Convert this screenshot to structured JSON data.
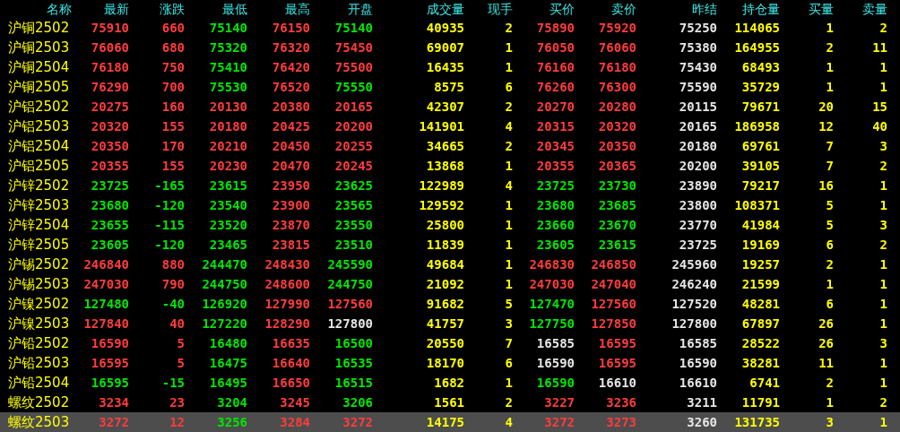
{
  "table": {
    "columns": [
      "名称",
      "最新",
      "涨跌",
      "最低",
      "最高",
      "开盘",
      "成交量",
      "现手",
      "买价",
      "卖价",
      "昨结",
      "持仓量",
      "买量",
      "卖量"
    ],
    "rows": [
      {
        "selected": false,
        "cells": [
          {
            "text": "沪铜2502",
            "color": "#ffff00"
          },
          {
            "text": "75910",
            "color": "#ff3c3c"
          },
          {
            "text": "660",
            "color": "#ff3c3c"
          },
          {
            "text": "75140",
            "color": "#00e600"
          },
          {
            "text": "76150",
            "color": "#ff3c3c"
          },
          {
            "text": "75140",
            "color": "#00e600"
          },
          {
            "text": "40935",
            "color": "#ffff00"
          },
          {
            "text": "2",
            "color": "#ffff00"
          },
          {
            "text": "75890",
            "color": "#ff3c3c"
          },
          {
            "text": "75920",
            "color": "#ff3c3c"
          },
          {
            "text": "75250",
            "color": "#e6e6e6"
          },
          {
            "text": "114065",
            "color": "#ffff00"
          },
          {
            "text": "1",
            "color": "#ffff00"
          },
          {
            "text": "2",
            "color": "#ffff00"
          }
        ]
      },
      {
        "selected": false,
        "cells": [
          {
            "text": "沪铜2503",
            "color": "#ffff00"
          },
          {
            "text": "76060",
            "color": "#ff3c3c"
          },
          {
            "text": "680",
            "color": "#ff3c3c"
          },
          {
            "text": "75320",
            "color": "#00e600"
          },
          {
            "text": "76320",
            "color": "#ff3c3c"
          },
          {
            "text": "75450",
            "color": "#ff3c3c"
          },
          {
            "text": "69007",
            "color": "#ffff00"
          },
          {
            "text": "1",
            "color": "#ffff00"
          },
          {
            "text": "76050",
            "color": "#ff3c3c"
          },
          {
            "text": "76060",
            "color": "#ff3c3c"
          },
          {
            "text": "75380",
            "color": "#e6e6e6"
          },
          {
            "text": "164955",
            "color": "#ffff00"
          },
          {
            "text": "2",
            "color": "#ffff00"
          },
          {
            "text": "11",
            "color": "#ffff00"
          }
        ]
      },
      {
        "selected": false,
        "cells": [
          {
            "text": "沪铜2504",
            "color": "#ffff00"
          },
          {
            "text": "76180",
            "color": "#ff3c3c"
          },
          {
            "text": "750",
            "color": "#ff3c3c"
          },
          {
            "text": "75410",
            "color": "#00e600"
          },
          {
            "text": "76420",
            "color": "#ff3c3c"
          },
          {
            "text": "75500",
            "color": "#ff3c3c"
          },
          {
            "text": "16435",
            "color": "#ffff00"
          },
          {
            "text": "1",
            "color": "#ffff00"
          },
          {
            "text": "76160",
            "color": "#ff3c3c"
          },
          {
            "text": "76180",
            "color": "#ff3c3c"
          },
          {
            "text": "75430",
            "color": "#e6e6e6"
          },
          {
            "text": "68493",
            "color": "#ffff00"
          },
          {
            "text": "1",
            "color": "#ffff00"
          },
          {
            "text": "1",
            "color": "#ffff00"
          }
        ]
      },
      {
        "selected": false,
        "cells": [
          {
            "text": "沪铜2505",
            "color": "#ffff00"
          },
          {
            "text": "76290",
            "color": "#ff3c3c"
          },
          {
            "text": "700",
            "color": "#ff3c3c"
          },
          {
            "text": "75530",
            "color": "#00e600"
          },
          {
            "text": "76520",
            "color": "#ff3c3c"
          },
          {
            "text": "75550",
            "color": "#00e600"
          },
          {
            "text": "8575",
            "color": "#ffff00"
          },
          {
            "text": "6",
            "color": "#ffff00"
          },
          {
            "text": "76260",
            "color": "#ff3c3c"
          },
          {
            "text": "76300",
            "color": "#ff3c3c"
          },
          {
            "text": "75590",
            "color": "#e6e6e6"
          },
          {
            "text": "35729",
            "color": "#ffff00"
          },
          {
            "text": "1",
            "color": "#ffff00"
          },
          {
            "text": "1",
            "color": "#ffff00"
          }
        ]
      },
      {
        "selected": false,
        "cells": [
          {
            "text": "沪铝2502",
            "color": "#ffff00"
          },
          {
            "text": "20275",
            "color": "#ff3c3c"
          },
          {
            "text": "160",
            "color": "#ff3c3c"
          },
          {
            "text": "20130",
            "color": "#ff3c3c"
          },
          {
            "text": "20380",
            "color": "#ff3c3c"
          },
          {
            "text": "20165",
            "color": "#ff3c3c"
          },
          {
            "text": "42307",
            "color": "#ffff00"
          },
          {
            "text": "2",
            "color": "#ffff00"
          },
          {
            "text": "20270",
            "color": "#ff3c3c"
          },
          {
            "text": "20280",
            "color": "#ff3c3c"
          },
          {
            "text": "20115",
            "color": "#e6e6e6"
          },
          {
            "text": "79671",
            "color": "#ffff00"
          },
          {
            "text": "20",
            "color": "#ffff00"
          },
          {
            "text": "15",
            "color": "#ffff00"
          }
        ]
      },
      {
        "selected": false,
        "cells": [
          {
            "text": "沪铝2503",
            "color": "#ffff00"
          },
          {
            "text": "20320",
            "color": "#ff3c3c"
          },
          {
            "text": "155",
            "color": "#ff3c3c"
          },
          {
            "text": "20180",
            "color": "#ff3c3c"
          },
          {
            "text": "20425",
            "color": "#ff3c3c"
          },
          {
            "text": "20200",
            "color": "#ff3c3c"
          },
          {
            "text": "141901",
            "color": "#ffff00"
          },
          {
            "text": "4",
            "color": "#ffff00"
          },
          {
            "text": "20315",
            "color": "#ff3c3c"
          },
          {
            "text": "20320",
            "color": "#ff3c3c"
          },
          {
            "text": "20165",
            "color": "#e6e6e6"
          },
          {
            "text": "186958",
            "color": "#ffff00"
          },
          {
            "text": "12",
            "color": "#ffff00"
          },
          {
            "text": "40",
            "color": "#ffff00"
          }
        ]
      },
      {
        "selected": false,
        "cells": [
          {
            "text": "沪铝2504",
            "color": "#ffff00"
          },
          {
            "text": "20350",
            "color": "#ff3c3c"
          },
          {
            "text": "170",
            "color": "#ff3c3c"
          },
          {
            "text": "20210",
            "color": "#ff3c3c"
          },
          {
            "text": "20450",
            "color": "#ff3c3c"
          },
          {
            "text": "20255",
            "color": "#ff3c3c"
          },
          {
            "text": "34665",
            "color": "#ffff00"
          },
          {
            "text": "2",
            "color": "#ffff00"
          },
          {
            "text": "20345",
            "color": "#ff3c3c"
          },
          {
            "text": "20350",
            "color": "#ff3c3c"
          },
          {
            "text": "20180",
            "color": "#e6e6e6"
          },
          {
            "text": "69761",
            "color": "#ffff00"
          },
          {
            "text": "7",
            "color": "#ffff00"
          },
          {
            "text": "3",
            "color": "#ffff00"
          }
        ]
      },
      {
        "selected": false,
        "cells": [
          {
            "text": "沪铝2505",
            "color": "#ffff00"
          },
          {
            "text": "20355",
            "color": "#ff3c3c"
          },
          {
            "text": "155",
            "color": "#ff3c3c"
          },
          {
            "text": "20230",
            "color": "#ff3c3c"
          },
          {
            "text": "20470",
            "color": "#ff3c3c"
          },
          {
            "text": "20245",
            "color": "#ff3c3c"
          },
          {
            "text": "13868",
            "color": "#ffff00"
          },
          {
            "text": "1",
            "color": "#ffff00"
          },
          {
            "text": "20355",
            "color": "#ff3c3c"
          },
          {
            "text": "20365",
            "color": "#ff3c3c"
          },
          {
            "text": "20200",
            "color": "#e6e6e6"
          },
          {
            "text": "39105",
            "color": "#ffff00"
          },
          {
            "text": "7",
            "color": "#ffff00"
          },
          {
            "text": "2",
            "color": "#ffff00"
          }
        ]
      },
      {
        "selected": false,
        "cells": [
          {
            "text": "沪锌2502",
            "color": "#ffff00"
          },
          {
            "text": "23725",
            "color": "#00e600"
          },
          {
            "text": "-165",
            "color": "#00e600"
          },
          {
            "text": "23615",
            "color": "#00e600"
          },
          {
            "text": "23950",
            "color": "#ff3c3c"
          },
          {
            "text": "23625",
            "color": "#00e600"
          },
          {
            "text": "122989",
            "color": "#ffff00"
          },
          {
            "text": "4",
            "color": "#ffff00"
          },
          {
            "text": "23725",
            "color": "#00e600"
          },
          {
            "text": "23730",
            "color": "#00e600"
          },
          {
            "text": "23890",
            "color": "#e6e6e6"
          },
          {
            "text": "79217",
            "color": "#ffff00"
          },
          {
            "text": "16",
            "color": "#ffff00"
          },
          {
            "text": "1",
            "color": "#ffff00"
          }
        ]
      },
      {
        "selected": false,
        "cells": [
          {
            "text": "沪锌2503",
            "color": "#ffff00"
          },
          {
            "text": "23680",
            "color": "#00e600"
          },
          {
            "text": "-120",
            "color": "#00e600"
          },
          {
            "text": "23540",
            "color": "#00e600"
          },
          {
            "text": "23900",
            "color": "#ff3c3c"
          },
          {
            "text": "23565",
            "color": "#00e600"
          },
          {
            "text": "129592",
            "color": "#ffff00"
          },
          {
            "text": "1",
            "color": "#ffff00"
          },
          {
            "text": "23680",
            "color": "#00e600"
          },
          {
            "text": "23685",
            "color": "#00e600"
          },
          {
            "text": "23800",
            "color": "#e6e6e6"
          },
          {
            "text": "108371",
            "color": "#ffff00"
          },
          {
            "text": "5",
            "color": "#ffff00"
          },
          {
            "text": "1",
            "color": "#ffff00"
          }
        ]
      },
      {
        "selected": false,
        "cells": [
          {
            "text": "沪锌2504",
            "color": "#ffff00"
          },
          {
            "text": "23655",
            "color": "#00e600"
          },
          {
            "text": "-115",
            "color": "#00e600"
          },
          {
            "text": "23520",
            "color": "#00e600"
          },
          {
            "text": "23870",
            "color": "#ff3c3c"
          },
          {
            "text": "23550",
            "color": "#00e600"
          },
          {
            "text": "25800",
            "color": "#ffff00"
          },
          {
            "text": "1",
            "color": "#ffff00"
          },
          {
            "text": "23660",
            "color": "#00e600"
          },
          {
            "text": "23670",
            "color": "#00e600"
          },
          {
            "text": "23770",
            "color": "#e6e6e6"
          },
          {
            "text": "41984",
            "color": "#ffff00"
          },
          {
            "text": "5",
            "color": "#ffff00"
          },
          {
            "text": "3",
            "color": "#ffff00"
          }
        ]
      },
      {
        "selected": false,
        "cells": [
          {
            "text": "沪锌2505",
            "color": "#ffff00"
          },
          {
            "text": "23605",
            "color": "#00e600"
          },
          {
            "text": "-120",
            "color": "#00e600"
          },
          {
            "text": "23465",
            "color": "#00e600"
          },
          {
            "text": "23815",
            "color": "#ff3c3c"
          },
          {
            "text": "23510",
            "color": "#00e600"
          },
          {
            "text": "11839",
            "color": "#ffff00"
          },
          {
            "text": "1",
            "color": "#ffff00"
          },
          {
            "text": "23605",
            "color": "#00e600"
          },
          {
            "text": "23615",
            "color": "#00e600"
          },
          {
            "text": "23725",
            "color": "#e6e6e6"
          },
          {
            "text": "19169",
            "color": "#ffff00"
          },
          {
            "text": "6",
            "color": "#ffff00"
          },
          {
            "text": "2",
            "color": "#ffff00"
          }
        ]
      },
      {
        "selected": false,
        "cells": [
          {
            "text": "沪锡2502",
            "color": "#ffff00"
          },
          {
            "text": "246840",
            "color": "#ff3c3c"
          },
          {
            "text": "880",
            "color": "#ff3c3c"
          },
          {
            "text": "244470",
            "color": "#00e600"
          },
          {
            "text": "248430",
            "color": "#ff3c3c"
          },
          {
            "text": "245590",
            "color": "#00e600"
          },
          {
            "text": "49684",
            "color": "#ffff00"
          },
          {
            "text": "1",
            "color": "#ffff00"
          },
          {
            "text": "246830",
            "color": "#ff3c3c"
          },
          {
            "text": "246850",
            "color": "#ff3c3c"
          },
          {
            "text": "245960",
            "color": "#e6e6e6"
          },
          {
            "text": "19257",
            "color": "#ffff00"
          },
          {
            "text": "2",
            "color": "#ffff00"
          },
          {
            "text": "1",
            "color": "#ffff00"
          }
        ]
      },
      {
        "selected": false,
        "cells": [
          {
            "text": "沪锡2503",
            "color": "#ffff00"
          },
          {
            "text": "247030",
            "color": "#ff3c3c"
          },
          {
            "text": "790",
            "color": "#ff3c3c"
          },
          {
            "text": "244750",
            "color": "#00e600"
          },
          {
            "text": "248600",
            "color": "#ff3c3c"
          },
          {
            "text": "244750",
            "color": "#00e600"
          },
          {
            "text": "21092",
            "color": "#ffff00"
          },
          {
            "text": "1",
            "color": "#ffff00"
          },
          {
            "text": "247030",
            "color": "#ff3c3c"
          },
          {
            "text": "247040",
            "color": "#ff3c3c"
          },
          {
            "text": "246240",
            "color": "#e6e6e6"
          },
          {
            "text": "21599",
            "color": "#ffff00"
          },
          {
            "text": "1",
            "color": "#ffff00"
          },
          {
            "text": "1",
            "color": "#ffff00"
          }
        ]
      },
      {
        "selected": false,
        "cells": [
          {
            "text": "沪镍2502",
            "color": "#ffff00"
          },
          {
            "text": "127480",
            "color": "#00e600"
          },
          {
            "text": "-40",
            "color": "#00e600"
          },
          {
            "text": "126920",
            "color": "#00e600"
          },
          {
            "text": "127990",
            "color": "#ff3c3c"
          },
          {
            "text": "127560",
            "color": "#ff3c3c"
          },
          {
            "text": "91682",
            "color": "#ffff00"
          },
          {
            "text": "5",
            "color": "#ffff00"
          },
          {
            "text": "127470",
            "color": "#00e600"
          },
          {
            "text": "127560",
            "color": "#ff3c3c"
          },
          {
            "text": "127520",
            "color": "#e6e6e6"
          },
          {
            "text": "48281",
            "color": "#ffff00"
          },
          {
            "text": "6",
            "color": "#ffff00"
          },
          {
            "text": "1",
            "color": "#ffff00"
          }
        ]
      },
      {
        "selected": false,
        "cells": [
          {
            "text": "沪镍2503",
            "color": "#ffff00"
          },
          {
            "text": "127840",
            "color": "#ff3c3c"
          },
          {
            "text": "40",
            "color": "#ff3c3c"
          },
          {
            "text": "127220",
            "color": "#00e600"
          },
          {
            "text": "128290",
            "color": "#ff3c3c"
          },
          {
            "text": "127800",
            "color": "#e6e6e6"
          },
          {
            "text": "41757",
            "color": "#ffff00"
          },
          {
            "text": "3",
            "color": "#ffff00"
          },
          {
            "text": "127750",
            "color": "#00e600"
          },
          {
            "text": "127850",
            "color": "#ff3c3c"
          },
          {
            "text": "127800",
            "color": "#e6e6e6"
          },
          {
            "text": "67897",
            "color": "#ffff00"
          },
          {
            "text": "26",
            "color": "#ffff00"
          },
          {
            "text": "1",
            "color": "#ffff00"
          }
        ]
      },
      {
        "selected": false,
        "cells": [
          {
            "text": "沪铅2502",
            "color": "#ffff00"
          },
          {
            "text": "16590",
            "color": "#ff3c3c"
          },
          {
            "text": "5",
            "color": "#ff3c3c"
          },
          {
            "text": "16480",
            "color": "#00e600"
          },
          {
            "text": "16635",
            "color": "#ff3c3c"
          },
          {
            "text": "16500",
            "color": "#00e600"
          },
          {
            "text": "20550",
            "color": "#ffff00"
          },
          {
            "text": "7",
            "color": "#ffff00"
          },
          {
            "text": "16585",
            "color": "#e6e6e6"
          },
          {
            "text": "16595",
            "color": "#ff3c3c"
          },
          {
            "text": "16585",
            "color": "#e6e6e6"
          },
          {
            "text": "28522",
            "color": "#ffff00"
          },
          {
            "text": "26",
            "color": "#ffff00"
          },
          {
            "text": "3",
            "color": "#ffff00"
          }
        ]
      },
      {
        "selected": false,
        "cells": [
          {
            "text": "沪铅2503",
            "color": "#ffff00"
          },
          {
            "text": "16595",
            "color": "#ff3c3c"
          },
          {
            "text": "5",
            "color": "#ff3c3c"
          },
          {
            "text": "16475",
            "color": "#00e600"
          },
          {
            "text": "16640",
            "color": "#ff3c3c"
          },
          {
            "text": "16535",
            "color": "#00e600"
          },
          {
            "text": "18170",
            "color": "#ffff00"
          },
          {
            "text": "6",
            "color": "#ffff00"
          },
          {
            "text": "16590",
            "color": "#e6e6e6"
          },
          {
            "text": "16595",
            "color": "#ff3c3c"
          },
          {
            "text": "16590",
            "color": "#e6e6e6"
          },
          {
            "text": "38281",
            "color": "#ffff00"
          },
          {
            "text": "11",
            "color": "#ffff00"
          },
          {
            "text": "1",
            "color": "#ffff00"
          }
        ]
      },
      {
        "selected": false,
        "cells": [
          {
            "text": "沪铅2504",
            "color": "#ffff00"
          },
          {
            "text": "16595",
            "color": "#00e600"
          },
          {
            "text": "-15",
            "color": "#00e600"
          },
          {
            "text": "16495",
            "color": "#00e600"
          },
          {
            "text": "16650",
            "color": "#ff3c3c"
          },
          {
            "text": "16515",
            "color": "#00e600"
          },
          {
            "text": "1682",
            "color": "#ffff00"
          },
          {
            "text": "1",
            "color": "#ffff00"
          },
          {
            "text": "16590",
            "color": "#00e600"
          },
          {
            "text": "16610",
            "color": "#e6e6e6"
          },
          {
            "text": "16610",
            "color": "#e6e6e6"
          },
          {
            "text": "6741",
            "color": "#ffff00"
          },
          {
            "text": "2",
            "color": "#ffff00"
          },
          {
            "text": "1",
            "color": "#ffff00"
          }
        ]
      },
      {
        "selected": false,
        "cells": [
          {
            "text": "螺纹2502",
            "color": "#ffff00"
          },
          {
            "text": "3234",
            "color": "#ff3c3c"
          },
          {
            "text": "23",
            "color": "#ff3c3c"
          },
          {
            "text": "3204",
            "color": "#00e600"
          },
          {
            "text": "3245",
            "color": "#ff3c3c"
          },
          {
            "text": "3206",
            "color": "#00e600"
          },
          {
            "text": "1561",
            "color": "#ffff00"
          },
          {
            "text": "2",
            "color": "#ffff00"
          },
          {
            "text": "3227",
            "color": "#ff3c3c"
          },
          {
            "text": "3236",
            "color": "#ff3c3c"
          },
          {
            "text": "3211",
            "color": "#e6e6e6"
          },
          {
            "text": "11791",
            "color": "#ffff00"
          },
          {
            "text": "1",
            "color": "#ffff00"
          },
          {
            "text": "2",
            "color": "#ffff00"
          }
        ]
      },
      {
        "selected": true,
        "cells": [
          {
            "text": "螺纹2503",
            "color": "#ffff00"
          },
          {
            "text": "3272",
            "color": "#ff3c3c"
          },
          {
            "text": "12",
            "color": "#ff3c3c"
          },
          {
            "text": "3256",
            "color": "#00e600"
          },
          {
            "text": "3284",
            "color": "#ff3c3c"
          },
          {
            "text": "3272",
            "color": "#ff3c3c"
          },
          {
            "text": "14175",
            "color": "#ffff00"
          },
          {
            "text": "4",
            "color": "#ffff00"
          },
          {
            "text": "3272",
            "color": "#ff3c3c"
          },
          {
            "text": "3273",
            "color": "#ff3c3c"
          },
          {
            "text": "3260",
            "color": "#e6e6e6"
          },
          {
            "text": "131735",
            "color": "#ffff00"
          },
          {
            "text": "3",
            "color": "#ffff00"
          },
          {
            "text": "1",
            "color": "#ffff00"
          }
        ]
      }
    ]
  }
}
